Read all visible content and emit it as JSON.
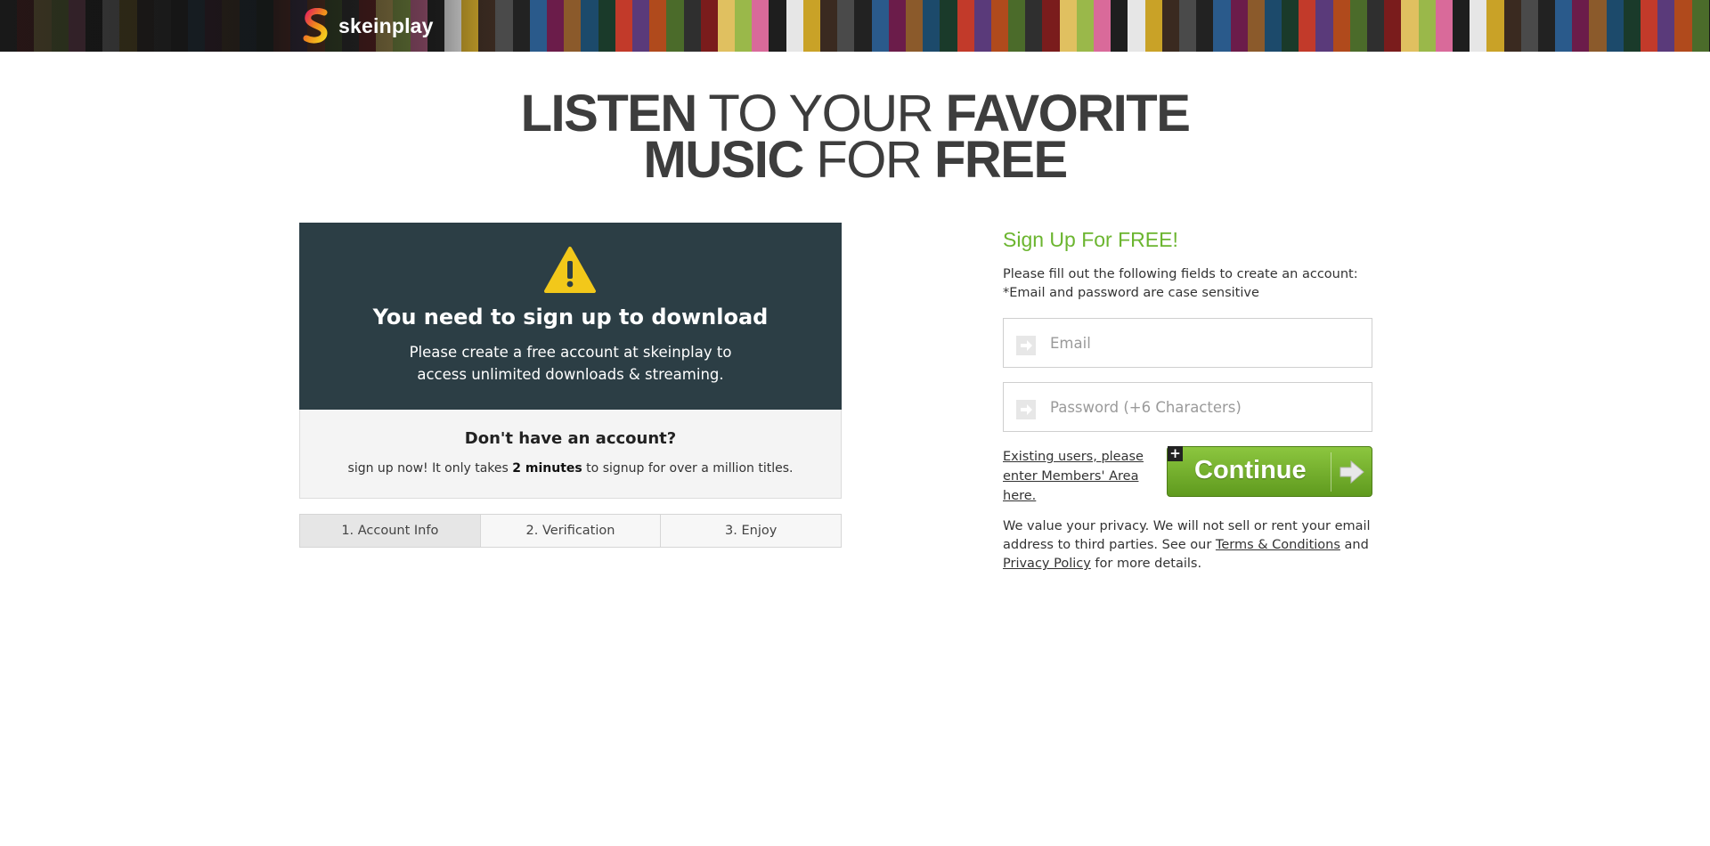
{
  "header": {
    "brand": "skeinplay",
    "tile_colors": [
      "#3a2a20",
      "#7a1c1c",
      "#1c4a6b",
      "#c9a227",
      "#2f2f2f",
      "#8b5a2b",
      "#e6e6e6",
      "#4b6b2a",
      "#6b1c4a",
      "#1e1e1e",
      "#b04a1c",
      "#2a5a8b",
      "#d96a9a",
      "#5a3a7a",
      "#222222",
      "#9ab84a",
      "#c23a2a",
      "#4a4a4a",
      "#e0c060",
      "#1a3a2a"
    ]
  },
  "headline": {
    "line1_bold1": "LISTEN",
    "line1_light": " TO YOUR ",
    "line1_bold2": "FAVORITE",
    "line2_bold1": "MUSIC",
    "line2_light": " FOR ",
    "line2_bold2": "FREE"
  },
  "notice": {
    "icon": "warning-icon",
    "title": "You need to sign up to download",
    "text": "Please create a free account at skeinplay to access unlimited downloads & streaming."
  },
  "no_account": {
    "title": "Don't have an account?",
    "text_before": "sign up now! It only takes ",
    "text_bold": "2 minutes",
    "text_after": " to signup for over a million titles."
  },
  "steps": [
    {
      "label": "1. Account Info",
      "active": true
    },
    {
      "label": "2. Verification",
      "active": false
    },
    {
      "label": "3. Enjoy",
      "active": false
    }
  ],
  "form": {
    "title": "Sign Up For FREE!",
    "desc_line1": "Please fill out the following fields to create an account:",
    "desc_line2": "*Email and password are case sensitive",
    "email_placeholder": "Email",
    "email_value": "",
    "password_placeholder": "Password (+6 Characters)",
    "password_value": "",
    "existing_link": "Existing users, please enter Members' Area here.",
    "continue_label": "Continue",
    "accent_color": "#6bb52f"
  },
  "privacy": {
    "text1": "We value your privacy. We will not sell or rent your email address to third parties. See our ",
    "terms_link": "Terms & Conditions",
    "text2": " and ",
    "privacy_link": "Privacy Policy",
    "text3": " for more details."
  }
}
